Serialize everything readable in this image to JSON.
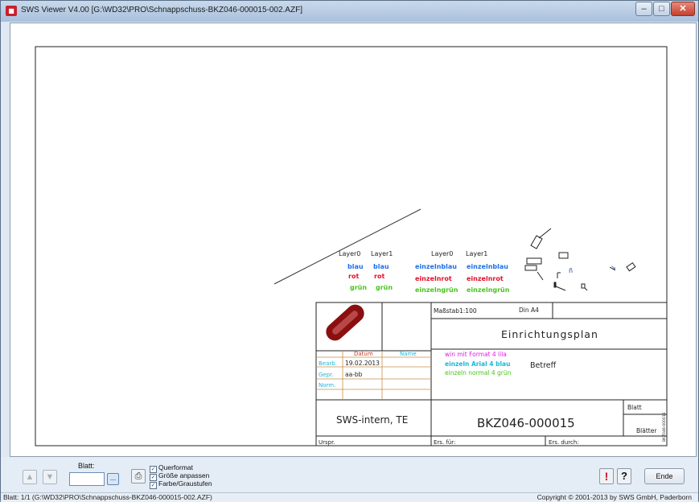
{
  "window": {
    "title": "SWS Viewer V4.00 [G:\\WD32\\PRO\\Schnappschuss-BKZ046-000015-002.AZF]",
    "icon": "app-logo-icon"
  },
  "window_controls": {
    "minimize": "–",
    "maximize": "□",
    "close": "✕"
  },
  "drawing": {
    "layer_labels": [
      "Layer0",
      "Layer1",
      "Layer0",
      "Layer1"
    ],
    "color_words": {
      "blau": "blau",
      "rot": "rot",
      "gruen": "grün",
      "einzelnblau": "einzelnblau",
      "einzelnrot": "einzelnrot",
      "einzelngruen": "einzelngrün"
    },
    "title_block": {
      "massstab_label": "Maßstab",
      "massstab_value": "1:100",
      "format": "Din A4",
      "plan_title": "Einrichtungsplan",
      "col_datum": "Datum",
      "col_name": "Name",
      "bearb_label": "Bearb.",
      "bearb_date": "19.02.2013",
      "gepr_label": "Gepr.",
      "gepr_value": "aa-bb",
      "norm_label": "Norm.",
      "line_magenta": "win mit Format 4 lila",
      "line_blue": "einzeln Arial 4 blau",
      "line_green": "einzeln normal 4 grün",
      "betreff": "Betreff",
      "company": "SWS-intern, TE",
      "drawing_number": "BKZ046-000015",
      "blatt": "Blatt",
      "blaetter": "Blätter",
      "urspr": "Urspr.",
      "ers_fuer": "Ers. für:",
      "ers_durch": "Ers. durch:",
      "side_code": "BKZ046-000015"
    },
    "colors": {
      "blue": "#1e6fe8",
      "red": "#e3102a",
      "green": "#46c61a",
      "magenta": "#e020e0",
      "cyan": "#18b8d8",
      "logo_red": "#8b0f0f"
    }
  },
  "toolbar": {
    "up_icon": "arrow-up-icon",
    "down_icon": "arrow-down-icon",
    "blatt_label": "Blatt:",
    "blatt_value": "",
    "browse_label": "...",
    "print_icon": "printer-icon",
    "checkboxes": [
      {
        "label": "Querformat",
        "checked": true
      },
      {
        "label": "Größe anpassen",
        "checked": true
      },
      {
        "label": "Farbe/Graustufen",
        "checked": true
      }
    ],
    "alert_label": "!",
    "help_label": "?",
    "ende_label": "Ende"
  },
  "status": {
    "left": "Blatt: 1/1 (G:\\WD32\\PRO\\Schnappschuss-BKZ046-000015-002.AZF)",
    "right": "Copyright © 2001-2013 by SWS GmbH, Paderborn"
  }
}
